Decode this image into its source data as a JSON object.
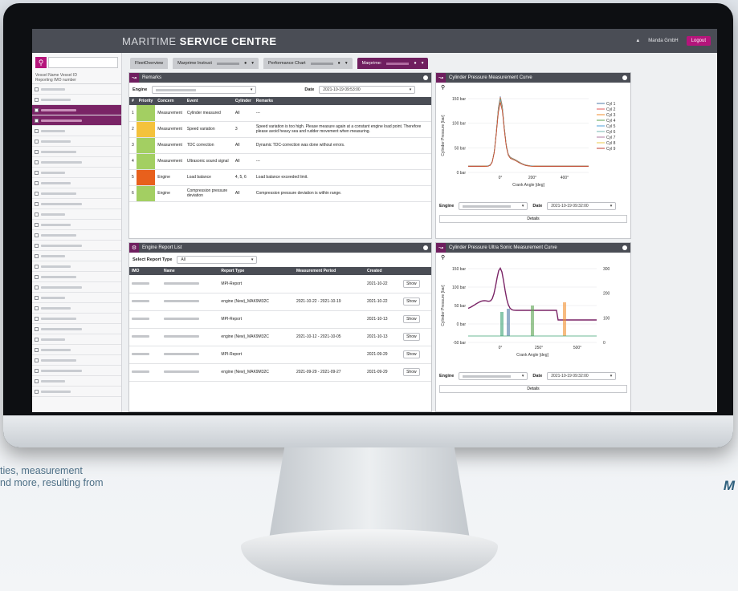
{
  "app": {
    "brand_light": "MARITIME ",
    "brand_bold": "SERVICE CENTRE",
    "user": "Manda GmbH",
    "logout": "Logout"
  },
  "sidebar": {
    "header_line1": "Vessel Name   Vessel ID",
    "header_line2": "Reporting   IMO number"
  },
  "tabs": [
    {
      "label": "FleetOverview"
    },
    {
      "label": "Marprime Instruct"
    },
    {
      "label": "Performance Chart"
    },
    {
      "label": "Marprime:"
    }
  ],
  "remarks": {
    "title": "Remarks",
    "engine_label": "Engine",
    "date_label": "Date",
    "date_value": "2021-10-19 09:53:00",
    "columns": [
      "#",
      "Priority",
      "Concern",
      "Event",
      "Cylinder",
      "Remarks"
    ],
    "rows": [
      {
        "n": "1",
        "color": "#a3cf62",
        "concern": "Measurement",
        "event": "Cylinder measured",
        "cyl": "All",
        "remark": "---"
      },
      {
        "n": "2",
        "color": "#f4c23c",
        "concern": "Measurement",
        "event": "Speed variation",
        "cyl": "3",
        "remark": "Speed variation is too high. Please measure again at a constant engine load point. Therefore please avoid heavy sea and rudder movement when measuring."
      },
      {
        "n": "3",
        "color": "#a3cf62",
        "concern": "Measurement",
        "event": "TDC correction",
        "cyl": "All",
        "remark": "Dynamic TDC-correction was done without errors."
      },
      {
        "n": "4",
        "color": "#a3cf62",
        "concern": "Measurement",
        "event": "Ultrasonic sound signal",
        "cyl": "All",
        "remark": "---"
      },
      {
        "n": "5",
        "color": "#e8601c",
        "concern": "Engine",
        "event": "Load balance",
        "cyl": "4, 5, 6",
        "remark": "Load balance exceeded limit."
      },
      {
        "n": "6",
        "color": "#a3cf62",
        "concern": "Engine",
        "event": "Compression pressure deviation",
        "cyl": "All",
        "remark": "Compression pressure deviation is within range."
      }
    ]
  },
  "reports": {
    "title": "Engine Report List",
    "select_label": "Select Report Type",
    "select_value": "All",
    "columns": [
      "IMO",
      "Name",
      "Report Type",
      "Measurement Period",
      "Created",
      ""
    ],
    "rows": [
      {
        "type": "MPI-Report",
        "period": "",
        "created": "2021-10-22"
      },
      {
        "type": "engine (New)_MAK9M32C",
        "period": "2021-10-22 - 2021-10-19",
        "created": "2021-10-22"
      },
      {
        "type": "MPI-Report",
        "period": "",
        "created": "2021-10-13"
      },
      {
        "type": "engine (New)_MAK9M32C",
        "period": "2021-10-12 - 2021-10-05",
        "created": "2021-10-13"
      },
      {
        "type": "MPI-Report",
        "period": "",
        "created": "2021-09-29"
      },
      {
        "type": "engine (New)_MAK9M32C",
        "period": "2021-09-29 - 2021-09-27",
        "created": "2021-09-29"
      }
    ],
    "show_label": "Show"
  },
  "chart1": {
    "title": "Cylinder Pressure Measurement Curve",
    "ylabel": "Cylinder Pressure [bar]",
    "xlabel": "Crank Angle [deg]",
    "yticks": [
      "150 bar",
      "100 bar",
      "50 bar",
      "0 bar"
    ],
    "xticks": [
      "0°",
      "200°",
      "400°"
    ],
    "legend": [
      "Cyl 1",
      "Cyl 2",
      "Cyl 3",
      "Cyl 4",
      "Cyl 5",
      "Cyl 6",
      "Cyl 7",
      "Cyl 8",
      "Cyl 9"
    ],
    "engine_label": "Engine",
    "date_label": "Date",
    "date_value": "2021-10-19 09:32:00",
    "details": "Details"
  },
  "chart2": {
    "title": "Cylinder Pressure Ultra Sonic Measurement Curve",
    "ylabel": "Cylinder Pressure [bar]",
    "xlabel": "Crank Angle [deg]",
    "yticks": [
      "150 bar",
      "100 bar",
      "50 bar",
      "0 bar",
      "-50 bar"
    ],
    "yticks_right": [
      "300",
      "200",
      "100",
      "0"
    ],
    "xticks": [
      "0°",
      "250°",
      "500°"
    ],
    "engine_label": "Engine",
    "date_label": "Date",
    "date_value": "2021-10-19 09:32:00",
    "details": "Details"
  },
  "caption": {
    "line1": "ties, measurement",
    "line2": "nd more, resulting from",
    "right": "M"
  },
  "colors": {
    "accent": "#6f1f5f",
    "logout": "#b5157b",
    "header": "#4a4d55"
  }
}
